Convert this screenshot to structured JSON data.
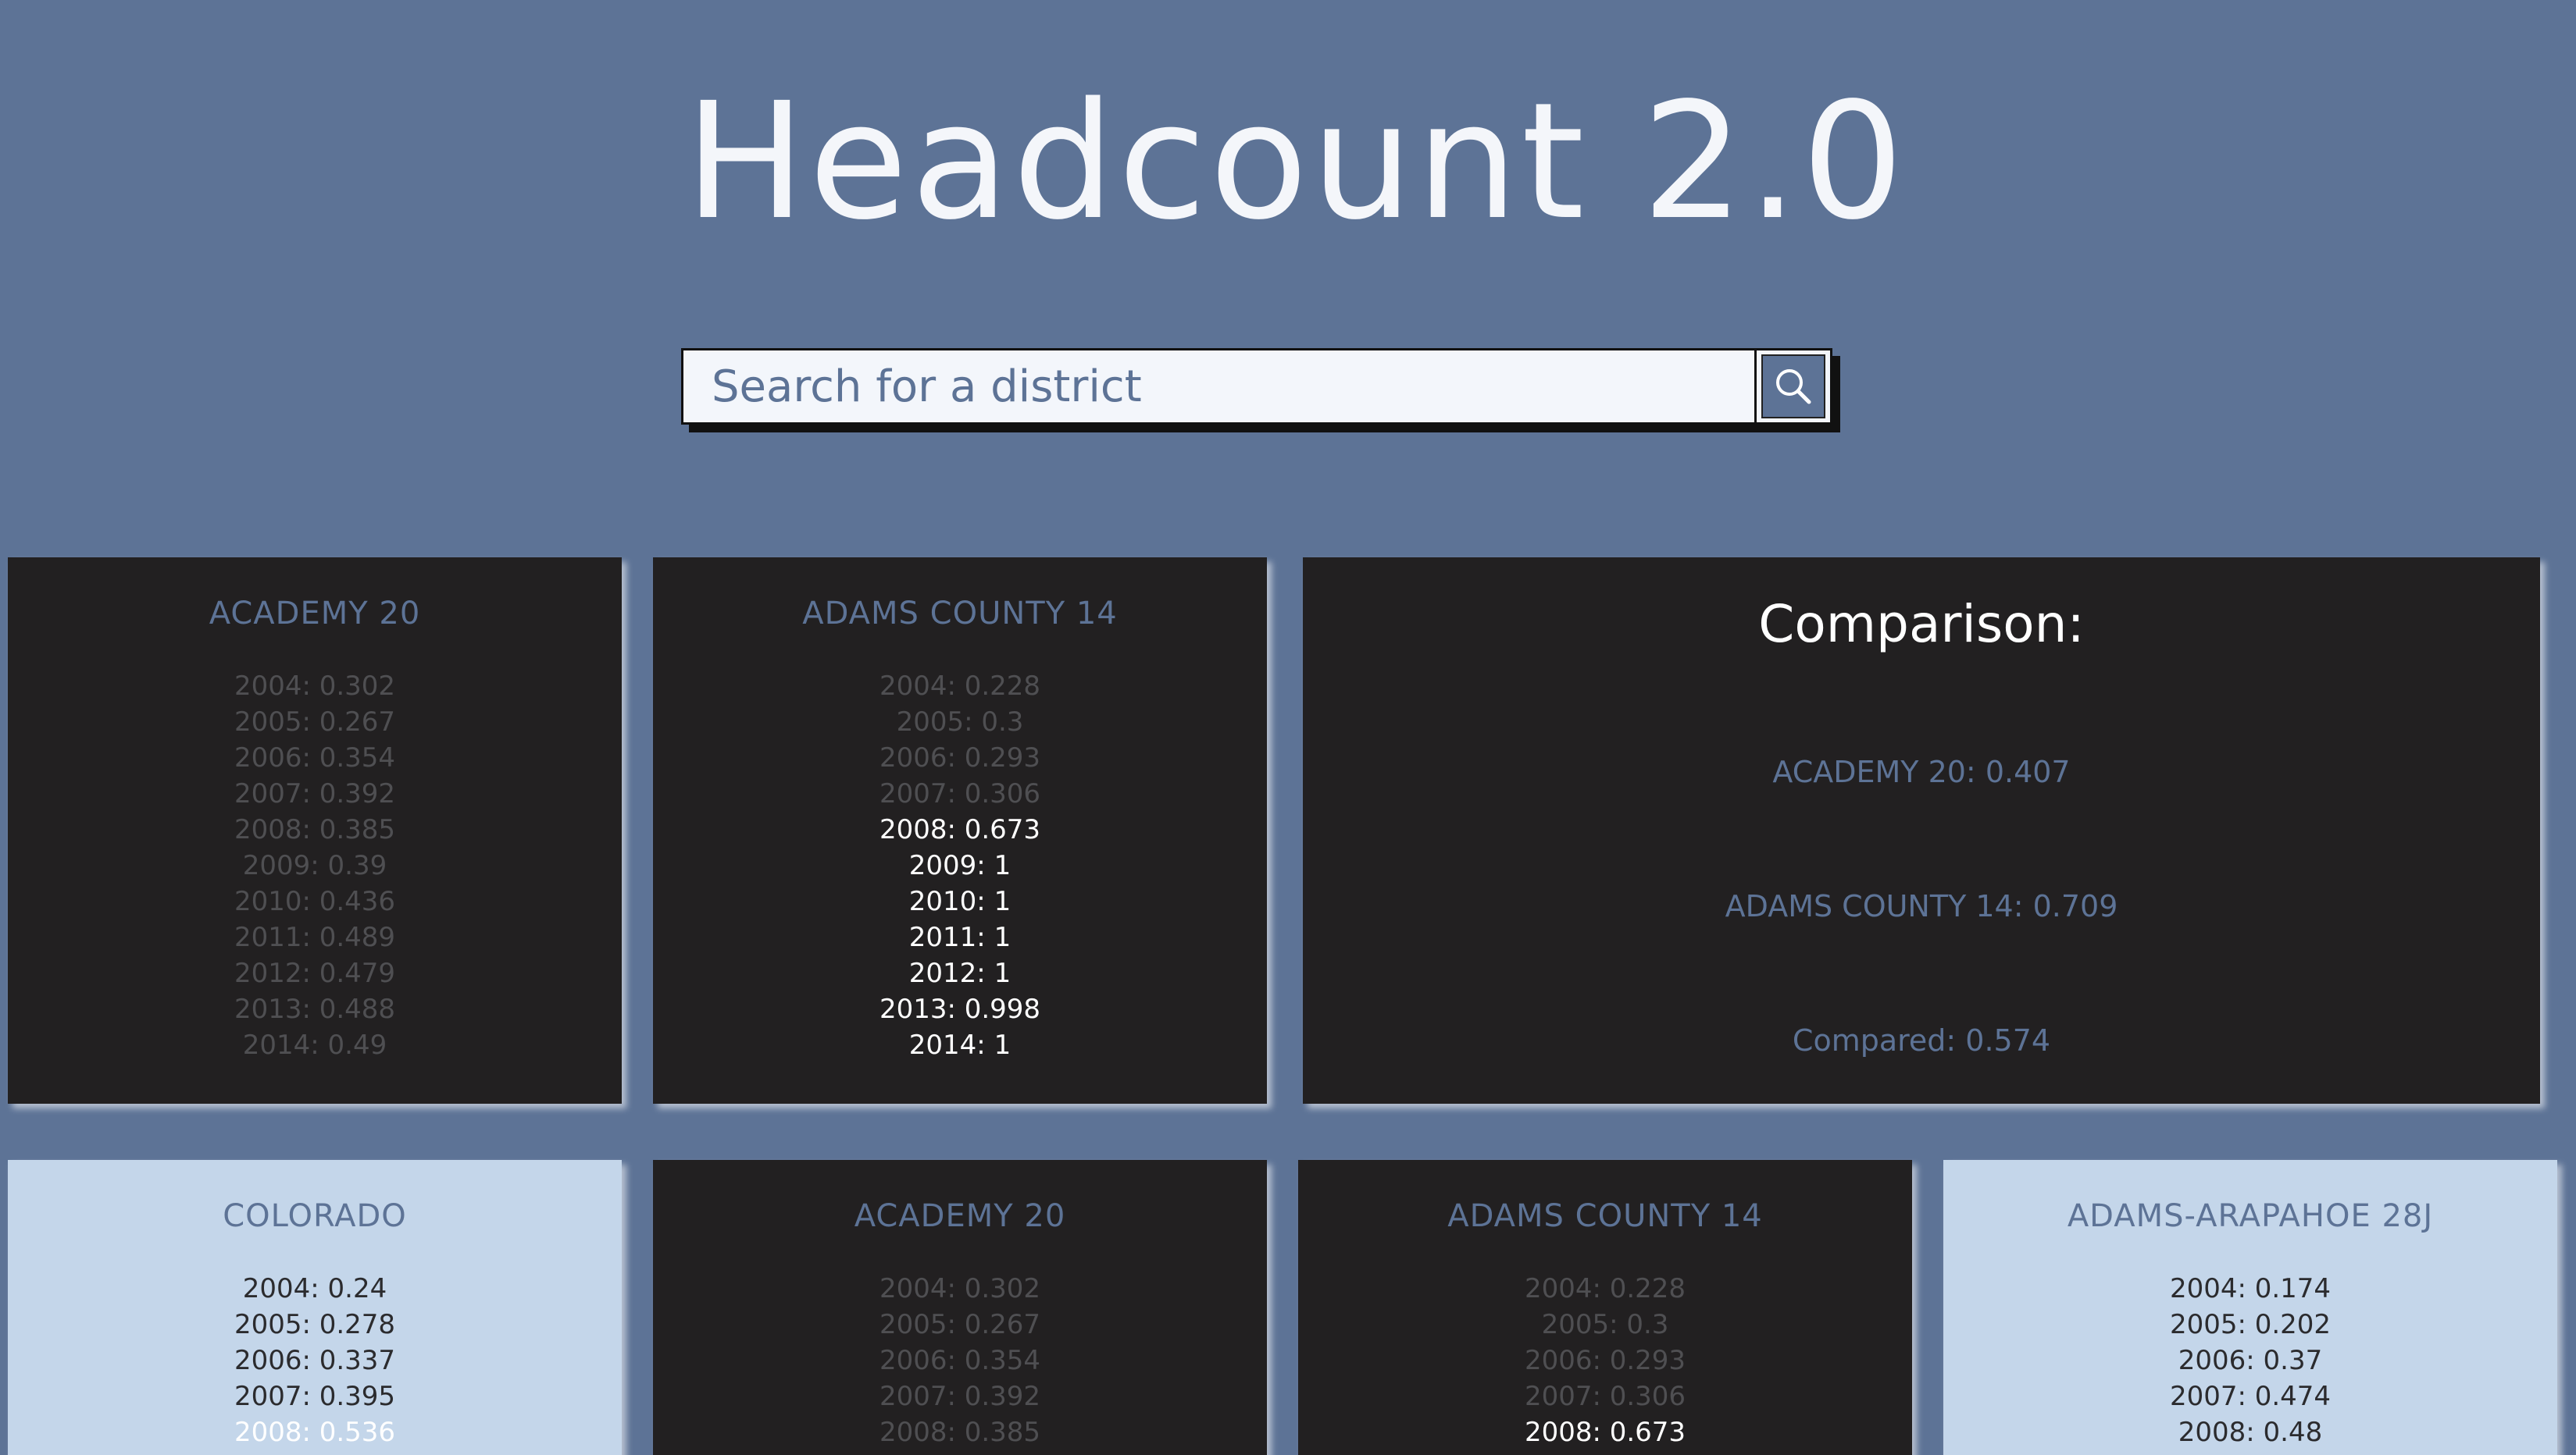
{
  "header": {
    "title": "Headcount 2.0"
  },
  "search": {
    "placeholder": "Search for a district",
    "icon": "search-icon"
  },
  "colors": {
    "background": "#5d7396",
    "dark_card": "#222021",
    "light_card": "#c4d6ea",
    "accent": "#5d7396"
  },
  "selected_cards": [
    {
      "name": "ACADEMY 20",
      "theme": "dark",
      "years": [
        {
          "text": "2004: 0.302",
          "high": false
        },
        {
          "text": "2005: 0.267",
          "high": false
        },
        {
          "text": "2006: 0.354",
          "high": false
        },
        {
          "text": "2007: 0.392",
          "high": false
        },
        {
          "text": "2008: 0.385",
          "high": false
        },
        {
          "text": "2009: 0.39",
          "high": false
        },
        {
          "text": "2010: 0.436",
          "high": false
        },
        {
          "text": "2011: 0.489",
          "high": false
        },
        {
          "text": "2012: 0.479",
          "high": false
        },
        {
          "text": "2013: 0.488",
          "high": false
        },
        {
          "text": "2014: 0.49",
          "high": false
        }
      ]
    },
    {
      "name": "ADAMS COUNTY 14",
      "theme": "dark",
      "years": [
        {
          "text": "2004: 0.228",
          "high": false
        },
        {
          "text": "2005: 0.3",
          "high": false
        },
        {
          "text": "2006: 0.293",
          "high": false
        },
        {
          "text": "2007: 0.306",
          "high": false
        },
        {
          "text": "2008: 0.673",
          "high": true
        },
        {
          "text": "2009: 1",
          "high": true
        },
        {
          "text": "2010: 1",
          "high": true
        },
        {
          "text": "2011: 1",
          "high": true
        },
        {
          "text": "2012: 1",
          "high": true
        },
        {
          "text": "2013: 0.998",
          "high": true
        },
        {
          "text": "2014: 1",
          "high": true
        }
      ]
    }
  ],
  "comparison": {
    "title": "Comparison:",
    "line1": "ACADEMY 20: 0.407",
    "line2": "ADAMS COUNTY 14: 0.709",
    "line3": "Compared: 0.574"
  },
  "district_cards": [
    {
      "name": "COLORADO",
      "theme": "light",
      "years": [
        {
          "text": "2004: 0.24",
          "high": false
        },
        {
          "text": "2005: 0.278",
          "high": false
        },
        {
          "text": "2006: 0.337",
          "high": false
        },
        {
          "text": "2007: 0.395",
          "high": false
        },
        {
          "text": "2008: 0.536",
          "high": true
        }
      ]
    },
    {
      "name": "ACADEMY 20",
      "theme": "dark",
      "years": [
        {
          "text": "2004: 0.302",
          "high": false
        },
        {
          "text": "2005: 0.267",
          "high": false
        },
        {
          "text": "2006: 0.354",
          "high": false
        },
        {
          "text": "2007: 0.392",
          "high": false
        },
        {
          "text": "2008: 0.385",
          "high": false
        }
      ]
    },
    {
      "name": "ADAMS COUNTY 14",
      "theme": "dark",
      "years": [
        {
          "text": "2004: 0.228",
          "high": false
        },
        {
          "text": "2005: 0.3",
          "high": false
        },
        {
          "text": "2006: 0.293",
          "high": false
        },
        {
          "text": "2007: 0.306",
          "high": false
        },
        {
          "text": "2008: 0.673",
          "high": true
        }
      ]
    },
    {
      "name": "ADAMS-ARAPAHOE 28J",
      "theme": "light",
      "years": [
        {
          "text": "2004: 0.174",
          "high": false
        },
        {
          "text": "2005: 0.202",
          "high": false
        },
        {
          "text": "2006: 0.37",
          "high": false
        },
        {
          "text": "2007: 0.474",
          "high": false
        },
        {
          "text": "2008: 0.48",
          "high": false
        }
      ]
    }
  ]
}
